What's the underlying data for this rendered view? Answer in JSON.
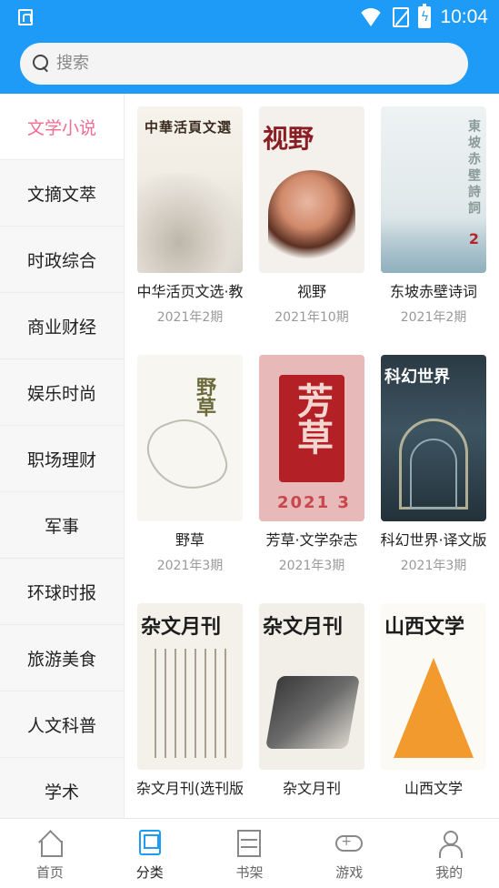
{
  "status_bar": {
    "time": "10:04",
    "icons": [
      "app-notification-icon",
      "wifi-icon",
      "no-sim-icon",
      "battery-charging-icon"
    ]
  },
  "search": {
    "placeholder": "搜索"
  },
  "sidebar": {
    "items": [
      {
        "label": "文学小说",
        "active": true
      },
      {
        "label": "文摘文萃",
        "active": false
      },
      {
        "label": "时政综合",
        "active": false
      },
      {
        "label": "商业财经",
        "active": false
      },
      {
        "label": "娱乐时尚",
        "active": false
      },
      {
        "label": "职场理财",
        "active": false
      },
      {
        "label": "军事",
        "active": false
      },
      {
        "label": "环球时报",
        "active": false
      },
      {
        "label": "旅游美食",
        "active": false
      },
      {
        "label": "人文科普",
        "active": false
      },
      {
        "label": "学术",
        "active": false
      }
    ]
  },
  "books": [
    {
      "title": "中华活页文选·教",
      "issue": "2021年2期",
      "cover_text": "中華活頁文選"
    },
    {
      "title": "视野",
      "issue": "2021年10期",
      "cover_text": "视野"
    },
    {
      "title": "东坡赤壁诗词",
      "issue": "2021年2期",
      "cover_text": "東坡赤壁詩詞"
    },
    {
      "title": "野草",
      "issue": "2021年3期",
      "cover_text": "野草"
    },
    {
      "title": "芳草·文学杂志",
      "issue": "2021年3期",
      "cover_text": "芳草"
    },
    {
      "title": "科幻世界·译文版",
      "issue": "2021年3期",
      "cover_text": "科幻世界"
    },
    {
      "title": "杂文月刊(选刊版",
      "issue": "",
      "cover_text": "杂文月刊"
    },
    {
      "title": "杂文月刊",
      "issue": "",
      "cover_text": "杂文月刊"
    },
    {
      "title": "山西文学",
      "issue": "",
      "cover_text": "山西文学"
    }
  ],
  "tabbar": {
    "tabs": [
      {
        "label": "首页",
        "icon": "home-icon",
        "active": false
      },
      {
        "label": "分类",
        "icon": "category-icon",
        "active": true
      },
      {
        "label": "书架",
        "icon": "bookshelf-icon",
        "active": false
      },
      {
        "label": "游戏",
        "icon": "gamepad-icon",
        "active": false
      },
      {
        "label": "我的",
        "icon": "profile-icon",
        "active": false
      }
    ]
  },
  "colors": {
    "header": "#1e9bf6",
    "accent_pink": "#f06c92",
    "tab_active": "#1e9bf6"
  }
}
